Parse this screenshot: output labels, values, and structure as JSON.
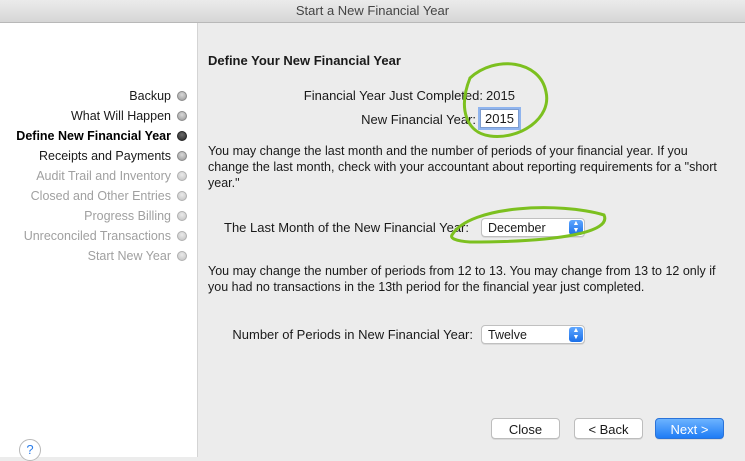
{
  "window": {
    "title": "Start a New Financial Year"
  },
  "sidebar": {
    "steps": [
      {
        "label": "Backup",
        "state": "done"
      },
      {
        "label": "What Will Happen",
        "state": "done"
      },
      {
        "label": "Define New Financial Year",
        "state": "current"
      },
      {
        "label": "Receipts and Payments",
        "state": "done"
      },
      {
        "label": "Audit Trail and Inventory",
        "state": "todo"
      },
      {
        "label": "Closed and Other Entries",
        "state": "todo"
      },
      {
        "label": "Progress Billing",
        "state": "todo"
      },
      {
        "label": "Unreconciled Transactions",
        "state": "todo"
      },
      {
        "label": "Start New Year",
        "state": "todo"
      }
    ],
    "help_icon": "?"
  },
  "main": {
    "heading": "Define Your New Financial Year",
    "completed_label": "Financial Year Just Completed:",
    "completed_value": "2015",
    "new_year_label": "New Financial Year:",
    "new_year_value": "2015",
    "para1": "You may change the last month and the number of periods of your financial year. If you change the last month, check with your accountant about reporting requirements for a \"short year.\"",
    "last_month_label": "The Last Month of the New Financial Year:",
    "last_month_value": "December",
    "para2": "You may change the number of periods from 12 to 13.  You may change from 13 to 12 only if you had no transactions in the 13th period for the financial year just completed.",
    "periods_label": "Number of Periods in New Financial Year:",
    "periods_value": "Twelve"
  },
  "buttons": {
    "close": "Close",
    "back": "< Back",
    "next": "Next >"
  },
  "colors": {
    "accent": "#1f7cf5",
    "annotation": "#7cc01f"
  }
}
